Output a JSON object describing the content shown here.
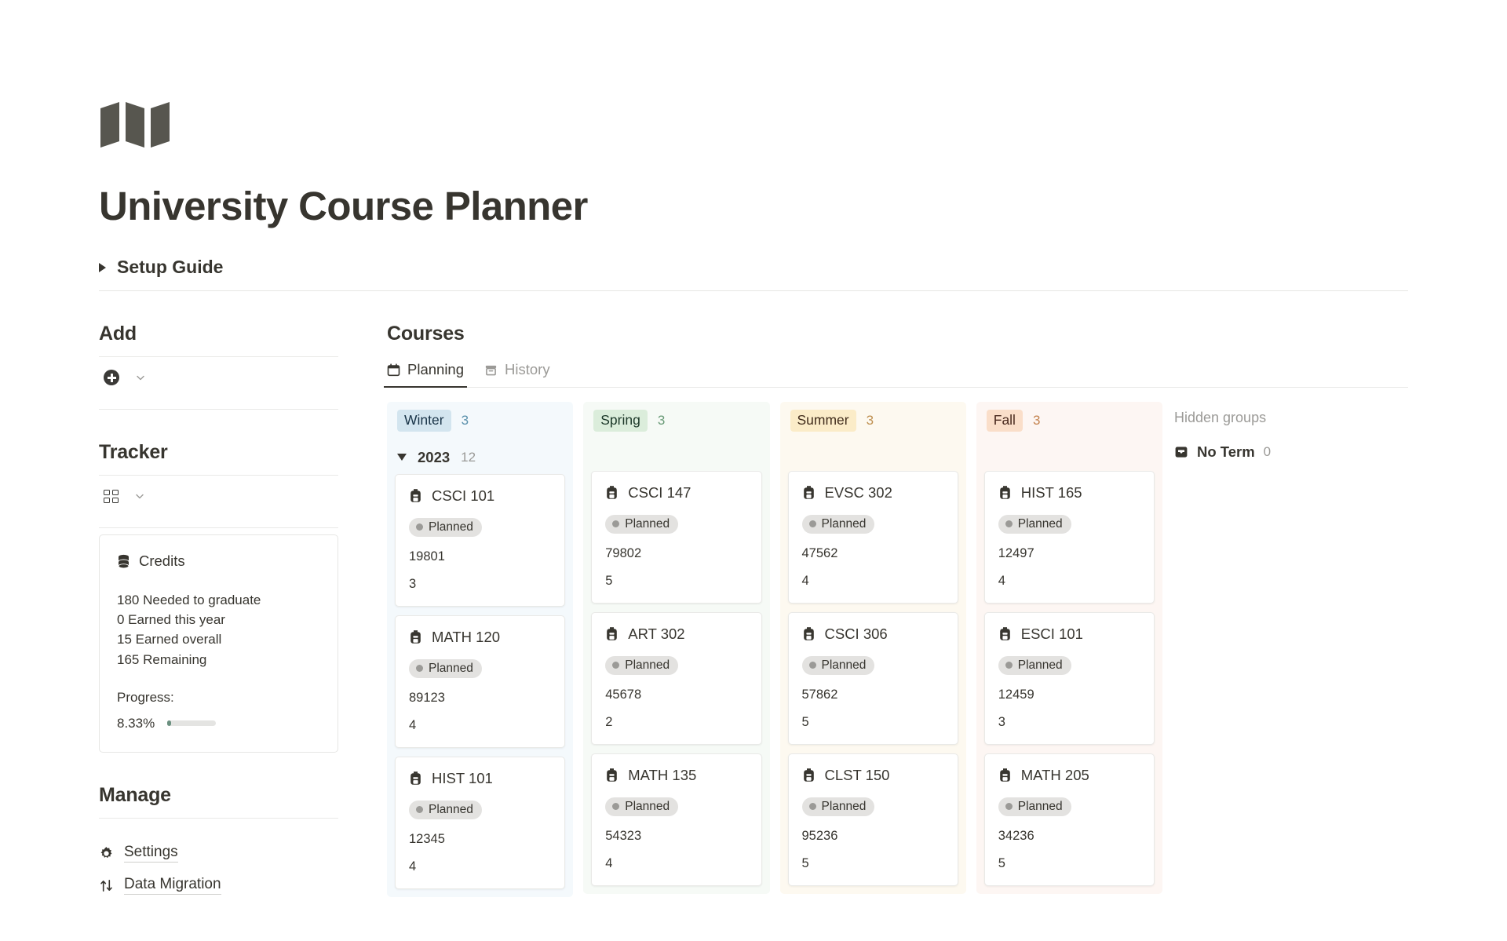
{
  "header": {
    "logo_icon": "map-logo-icon",
    "title": "University Course Planner",
    "setup_guide": "Setup Guide",
    "setup_toggle_icon": "triangle-right-icon"
  },
  "sidebar": {
    "add": {
      "title": "Add",
      "plus_icon": "plus-circle-icon",
      "chevron_icon": "chevron-down-icon"
    },
    "tracker": {
      "title": "Tracker",
      "gallery_icon": "gallery-grid-icon",
      "chevron_icon": "chevron-down-icon",
      "credits": {
        "db_icon": "database-icon",
        "title": "Credits",
        "lines": [
          "180 Needed to graduate",
          "0 Earned this year",
          "15 Earned overall",
          "165 Remaining"
        ],
        "progress_label": "Progress:",
        "progress_value": "8.33%",
        "progress_percent": 8.33,
        "progress_color": "#6b9080"
      }
    },
    "manage": {
      "title": "Manage",
      "items": [
        {
          "label": "Settings",
          "icon": "gear-icon"
        },
        {
          "label": "Data Migration",
          "icon": "arrows-up-down-icon"
        }
      ]
    }
  },
  "main": {
    "title": "Courses",
    "tabs": [
      {
        "label": "Planning",
        "icon": "calendar-icon",
        "active": true
      },
      {
        "label": "History",
        "icon": "archive-icon",
        "active": false
      }
    ],
    "group_row": {
      "toggle_icon": "triangle-down-icon",
      "year": "2023",
      "count": "12"
    },
    "columns": [
      {
        "name": "Winter",
        "count": "3",
        "pill_bg": "#d3e5ef",
        "pill_text": "#183347",
        "count_color": "#5b91ac",
        "col_bg": "#f4f9fc",
        "cards": [
          {
            "icon": "backpack-icon",
            "title": "CSCI 101",
            "status": "Planned",
            "code": "19801",
            "credits": "3"
          },
          {
            "icon": "backpack-icon",
            "title": "MATH 120",
            "status": "Planned",
            "code": "89123",
            "credits": "4"
          },
          {
            "icon": "backpack-icon",
            "title": "HIST 101",
            "status": "Planned",
            "code": "12345",
            "credits": "4"
          }
        ]
      },
      {
        "name": "Spring",
        "count": "3",
        "pill_bg": "#dbeddb",
        "pill_text": "#1c3829",
        "count_color": "#6a9b78",
        "col_bg": "#f6faf6",
        "cards": [
          {
            "icon": "backpack-icon",
            "title": "CSCI 147",
            "status": "Planned",
            "code": "79802",
            "credits": "5"
          },
          {
            "icon": "backpack-icon",
            "title": "ART 302",
            "status": "Planned",
            "code": "45678",
            "credits": "2"
          },
          {
            "icon": "backpack-icon",
            "title": "MATH 135",
            "status": "Planned",
            "code": "54323",
            "credits": "4"
          }
        ]
      },
      {
        "name": "Summer",
        "count": "3",
        "pill_bg": "#fbecc8",
        "pill_text": "#402c1b",
        "count_color": "#bf9050",
        "col_bg": "#fdf9f0",
        "cards": [
          {
            "icon": "backpack-icon",
            "title": "EVSC 302",
            "status": "Planned",
            "code": "47562",
            "credits": "4"
          },
          {
            "icon": "backpack-icon",
            "title": "CSCI 306",
            "status": "Planned",
            "code": "57862",
            "credits": "5"
          },
          {
            "icon": "backpack-icon",
            "title": "CLST 150",
            "status": "Planned",
            "code": "95236",
            "credits": "5"
          }
        ]
      },
      {
        "name": "Fall",
        "count": "3",
        "pill_bg": "#fadec9",
        "pill_text": "#49291e",
        "count_color": "#c4834f",
        "col_bg": "#fdf6f3",
        "cards": [
          {
            "icon": "backpack-icon",
            "title": "HIST 165",
            "status": "Planned",
            "code": "12497",
            "credits": "4"
          },
          {
            "icon": "backpack-icon",
            "title": "ESCI 101",
            "status": "Planned",
            "code": "12459",
            "credits": "3"
          },
          {
            "icon": "backpack-icon",
            "title": "MATH 205",
            "status": "Planned",
            "code": "34236",
            "credits": "5"
          }
        ]
      }
    ],
    "hidden_groups": {
      "title": "Hidden groups",
      "items": [
        {
          "icon": "inbox-icon",
          "label": "No Term",
          "count": "0"
        }
      ]
    }
  }
}
